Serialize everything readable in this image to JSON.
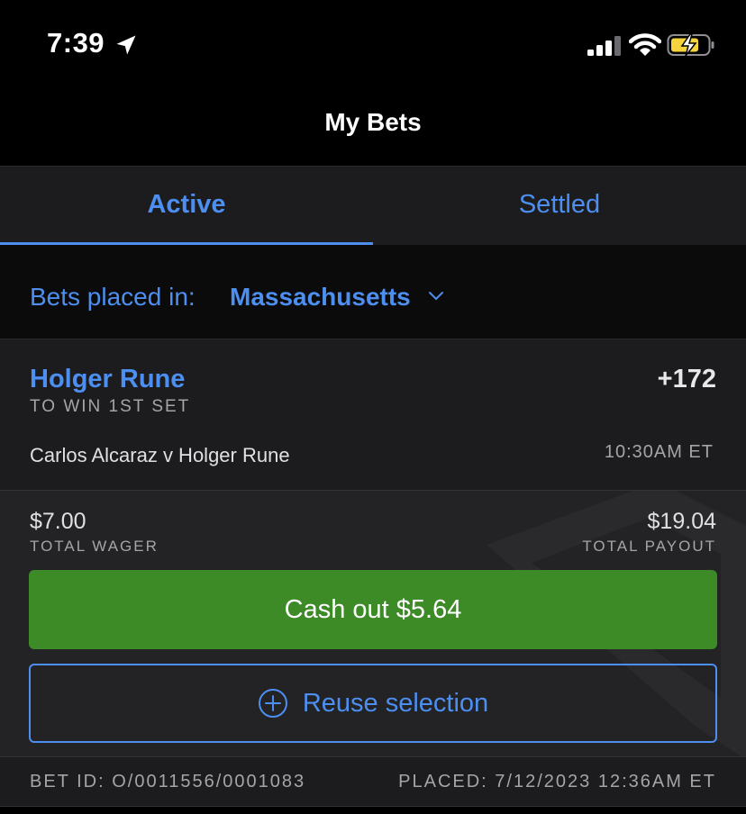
{
  "status_bar": {
    "time": "7:39"
  },
  "header": {
    "title": "My Bets"
  },
  "tabs": [
    {
      "label": "Active",
      "active": true
    },
    {
      "label": "Settled",
      "active": false
    }
  ],
  "region": {
    "label": "Bets placed in:",
    "value": "Massachusetts"
  },
  "bet": {
    "selection": "Holger Rune",
    "odds": "+172",
    "market": "TO WIN 1ST SET",
    "matchup": "Carlos Alcaraz v Holger Rune",
    "event_time": "10:30AM ET",
    "total_wager": "$7.00",
    "total_wager_label": "TOTAL WAGER",
    "total_payout": "$19.04",
    "total_payout_label": "TOTAL PAYOUT",
    "cashout_label": "Cash out $5.64",
    "reuse_label": "Reuse selection",
    "bet_id": "BET ID: O/0011556/0001083",
    "placed": "PLACED: 7/12/2023 12:36AM ET"
  },
  "colors": {
    "accent": "#4c8ff0",
    "cashout_green": "#3d8b27",
    "background": "#000000",
    "card": "#1c1c1e",
    "battery_yellow": "#f4d33d"
  },
  "icons": [
    "location-arrow-icon",
    "cellular-signal-icon",
    "wifi-icon",
    "battery-charging-icon",
    "chevron-down-icon",
    "plus-circle-icon",
    "watermark-logo-icon"
  ]
}
